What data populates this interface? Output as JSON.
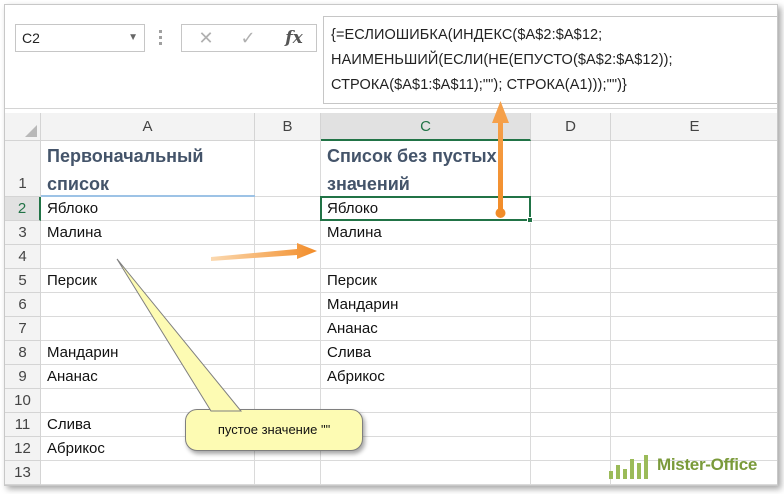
{
  "name_box": {
    "value": "C2"
  },
  "formula_bar": {
    "cancel_symbol": "✕",
    "enter_symbol": "✓",
    "function_symbol": "fx",
    "formula_lines": [
      "{=ЕСЛИОШИБКА(ИНДЕКС($A$2:$A$12;",
      "НАИМЕНЬШИЙ(ЕСЛИ(НЕ(ЕПУСТО($A$2:$A$12));",
      "СТРОКА($A$1:$A$11);\"\"); СТРОКА(A1)));\"\")}"
    ]
  },
  "columns": [
    "A",
    "B",
    "C",
    "D",
    "E"
  ],
  "rows": [
    "1",
    "2",
    "3",
    "4",
    "5",
    "6",
    "7",
    "8",
    "9",
    "10",
    "11",
    "12",
    "13"
  ],
  "headers": {
    "col_a_line1": "Первоначальный",
    "col_a_line2": "список",
    "col_c_line1": "Список без пустых",
    "col_c_line2": "значений"
  },
  "column_a_values": [
    "Яблоко",
    "Малина",
    "",
    "Персик",
    "",
    "",
    "Мандарин",
    "Ананас",
    "",
    "Слива",
    "Абрикос",
    ""
  ],
  "column_c_values": [
    "Яблоко",
    "Малина",
    "",
    "Персик",
    "Мандарин",
    "Ананас",
    "Слива",
    "Абрикос",
    "",
    "",
    "",
    ""
  ],
  "active_cell": "C2",
  "callout": {
    "text": "пустое значение \"\""
  },
  "watermark": {
    "text": "Mister-Office"
  },
  "colors": {
    "accent_green": "#217346",
    "arrow_orange": "#f28c28",
    "callout_fill": "#fdfbb3",
    "header_text": "#44546a"
  }
}
